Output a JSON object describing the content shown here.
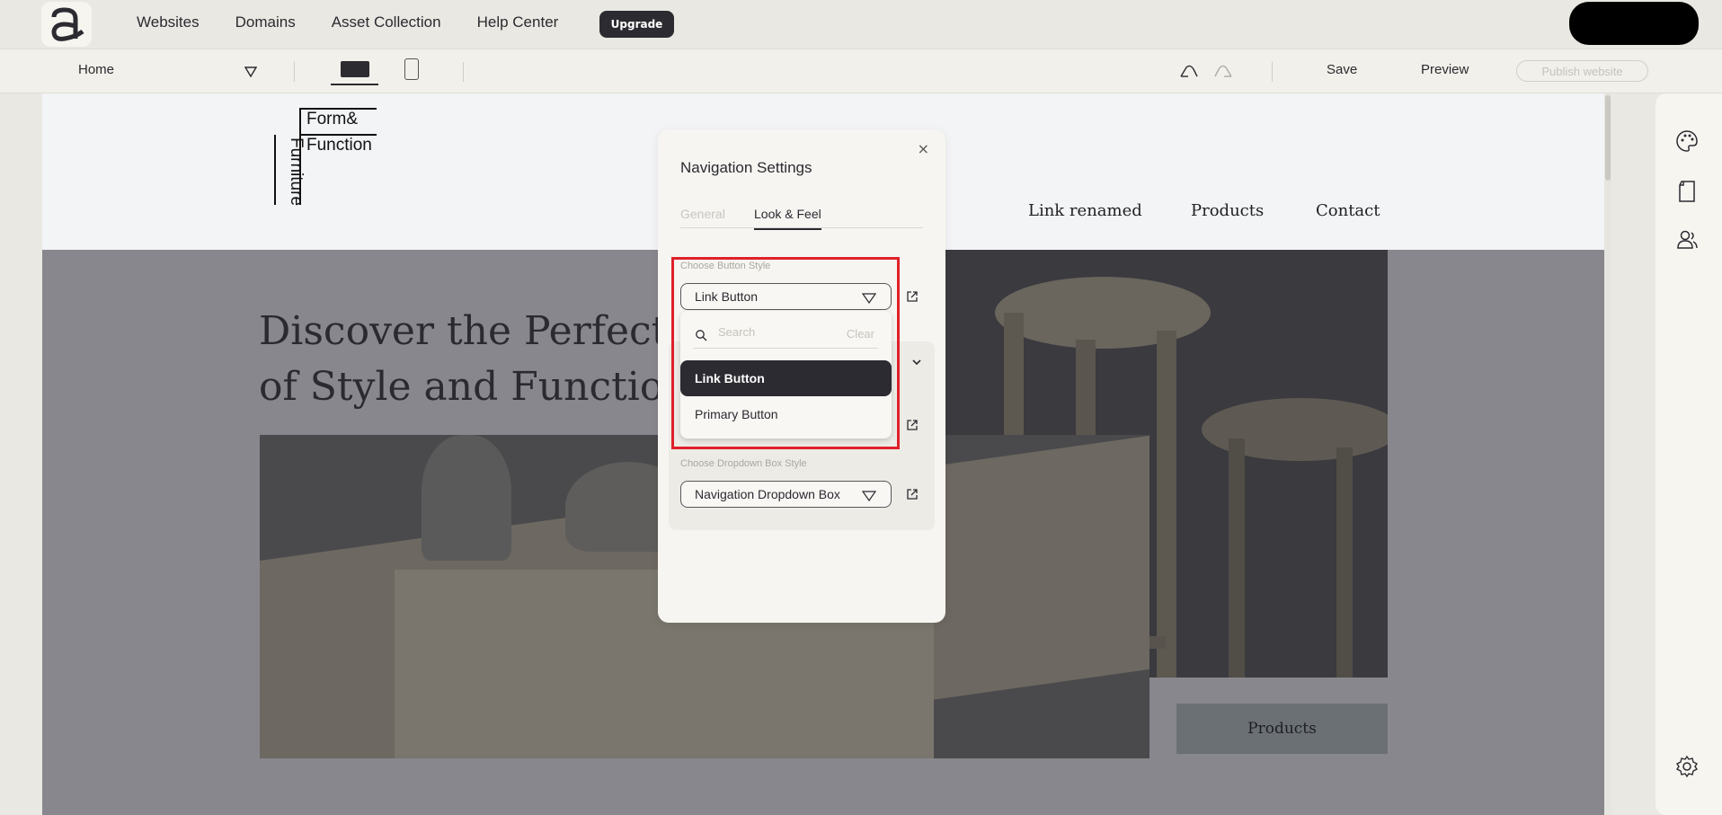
{
  "topnav": {
    "items": [
      "Websites",
      "Domains",
      "Asset Collection",
      "Help Center"
    ],
    "upgrade_label": "Upgrade"
  },
  "toolbar": {
    "page_selector": "Home",
    "save_label": "Save",
    "preview_label": "Preview",
    "publish_label": "Publish website"
  },
  "site": {
    "logo": {
      "line1": "Form&",
      "line2": "Function",
      "vertical": "Furniture"
    },
    "nav": [
      "Link renamed",
      "Products",
      "Contact"
    ],
    "hero_title_line1": "Discover the Perfect",
    "hero_title_line2": "of Style and Function",
    "products_button": "Products"
  },
  "modal": {
    "title": "Navigation Settings",
    "close_glyph": "×",
    "tabs": [
      "General",
      "Look & Feel"
    ],
    "active_tab": "Look & Feel",
    "button_style_label": "Choose Button Style",
    "button_style_value": "Link Button",
    "dropdown": {
      "search_placeholder": "Search",
      "clear_label": "Clear",
      "options": [
        "Link Button",
        "Primary Button"
      ],
      "selected": "Link Button"
    },
    "dropdown_box_label": "Choose Dropdown Box Style",
    "dropdown_box_value": "Navigation Dropdown Box"
  },
  "colors": {
    "accent_dark": "#2c2b31",
    "highlight": "#e0202a",
    "background": "#e9e8e2"
  }
}
